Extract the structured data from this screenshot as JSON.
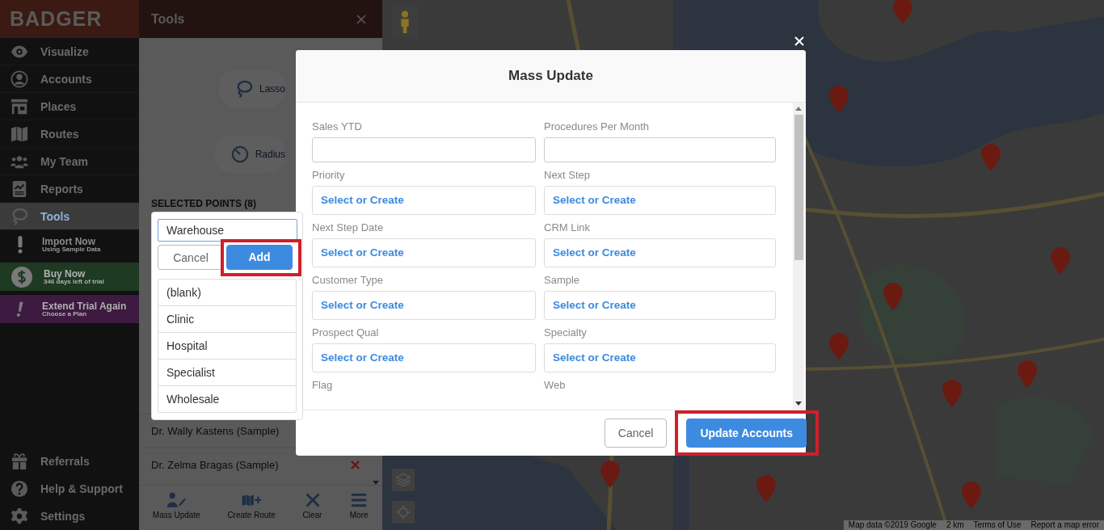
{
  "sidebar": {
    "logo": "BADGER",
    "items": [
      {
        "label": "Visualize",
        "selected": false
      },
      {
        "label": "Accounts",
        "selected": false
      },
      {
        "label": "Places",
        "selected": false
      },
      {
        "label": "Routes",
        "selected": false
      },
      {
        "label": "My Team",
        "selected": false
      },
      {
        "label": "Reports",
        "selected": false
      },
      {
        "label": "Tools",
        "selected": true
      }
    ],
    "promos": [
      {
        "kind": "import",
        "title": "Import Now",
        "subtitle": "Using Sample Data"
      },
      {
        "kind": "buy",
        "title": "Buy Now",
        "subtitle": "346 days left of trial"
      },
      {
        "kind": "trial",
        "title": "Extend Trial Again",
        "subtitle": "Choose a Plan"
      }
    ],
    "bottom_items": [
      "Referrals",
      "Help & Support",
      "Settings"
    ]
  },
  "tools_panel": {
    "title": "Tools",
    "tools": [
      "Lasso",
      "Radius"
    ],
    "section_title": "SELECTED POINTS (8)",
    "points": [
      {
        "name": "Dr. Wally Kastens (Sample)"
      },
      {
        "name": "Dr. Zelma Bragas (Sample)",
        "removable": true
      }
    ],
    "actions": [
      "Mass Update",
      "Create Route",
      "Clear",
      "More"
    ]
  },
  "map": {
    "attribution": [
      "Map data ©2019 Google",
      "2 km",
      "Terms of Use",
      "Report a map error"
    ]
  },
  "modal": {
    "title": "Mass Update",
    "fields": [
      {
        "label": "Sales YTD",
        "kind": "text"
      },
      {
        "label": "Procedures Per Month",
        "kind": "text"
      },
      {
        "label": "Priority",
        "kind": "select",
        "placeholder": "Select or Create"
      },
      {
        "label": "Next Step",
        "kind": "select",
        "placeholder": "Select or Create"
      },
      {
        "label": "Next Step Date",
        "kind": "select",
        "placeholder": "Select or Create"
      },
      {
        "label": "CRM Link",
        "kind": "select",
        "placeholder": "Select or Create"
      },
      {
        "label": "Customer Type",
        "kind": "select",
        "placeholder": "Select or Create"
      },
      {
        "label": "Sample",
        "kind": "select",
        "placeholder": "Select or Create"
      },
      {
        "label": "Prospect Qual",
        "kind": "select",
        "placeholder": "Select or Create"
      },
      {
        "label": "Specialty",
        "kind": "select",
        "placeholder": "Select or Create"
      },
      {
        "label": "Flag",
        "kind": "label"
      },
      {
        "label": "Web",
        "kind": "label"
      }
    ],
    "buttons": [
      {
        "label": "Cancel",
        "kind": "secondary",
        "highlighted": false
      },
      {
        "label": "Update Accounts",
        "kind": "primary",
        "highlighted": true
      }
    ]
  },
  "popup": {
    "value": "Warehouse",
    "buttons": [
      {
        "label": "Cancel",
        "kind": "secondary",
        "highlighted": false
      },
      {
        "label": "Add",
        "kind": "primary",
        "highlighted": true
      }
    ],
    "options": [
      "(blank)",
      "Clinic",
      "Hospital",
      "Specialist",
      "Wholesale"
    ]
  }
}
